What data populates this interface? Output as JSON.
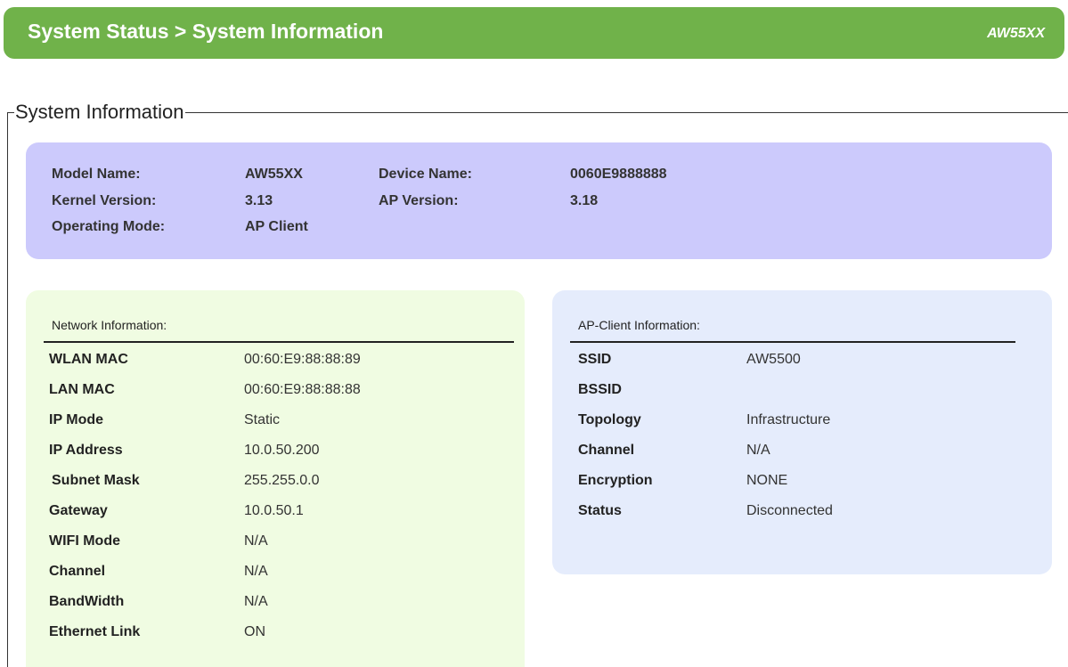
{
  "header": {
    "breadcrumb": "System Status > System Information",
    "model": "AW55XX"
  },
  "section_title": "System Information",
  "summary": {
    "model_name_label": "Model Name:",
    "model_name_value": "AW55XX",
    "device_name_label": "Device Name:",
    "device_name_value": "0060E9888888",
    "kernel_version_label": "Kernel Version:",
    "kernel_version_value": "3.13",
    "ap_version_label": "AP Version:",
    "ap_version_value": "3.18",
    "operating_mode_label": "Operating Mode:",
    "operating_mode_value": "AP Client"
  },
  "network": {
    "title": "Network Information:",
    "rows": [
      {
        "label": "WLAN MAC",
        "value": "00:60:E9:88:88:89"
      },
      {
        "label": "LAN MAC",
        "value": "00:60:E9:88:88:88"
      },
      {
        "label": "IP Mode",
        "value": "Static"
      },
      {
        "label": "IP Address",
        "value": "10.0.50.200"
      },
      {
        "label": "Subnet Mask",
        "value": "255.255.0.0"
      },
      {
        "label": "Gateway",
        "value": "10.0.50.1"
      },
      {
        "label": "WIFI Mode",
        "value": "N/A"
      },
      {
        "label": "Channel",
        "value": "N/A"
      },
      {
        "label": "BandWidth",
        "value": "N/A"
      },
      {
        "label": "Ethernet Link",
        "value": "ON"
      }
    ]
  },
  "ap_client": {
    "title": "AP-Client Information:",
    "rows": [
      {
        "label": "SSID",
        "value": "AW5500"
      },
      {
        "label": "BSSID",
        "value": ""
      },
      {
        "label": "Topology",
        "value": "Infrastructure"
      },
      {
        "label": "Channel",
        "value": "N/A"
      },
      {
        "label": "Encryption",
        "value": "NONE"
      },
      {
        "label": "Status",
        "value": "Disconnected"
      }
    ]
  },
  "colors": {
    "header": "#70b24a",
    "summary_panel": "#cccafc",
    "network_panel": "#f0fce2",
    "ap_panel": "#e5ecfc"
  }
}
